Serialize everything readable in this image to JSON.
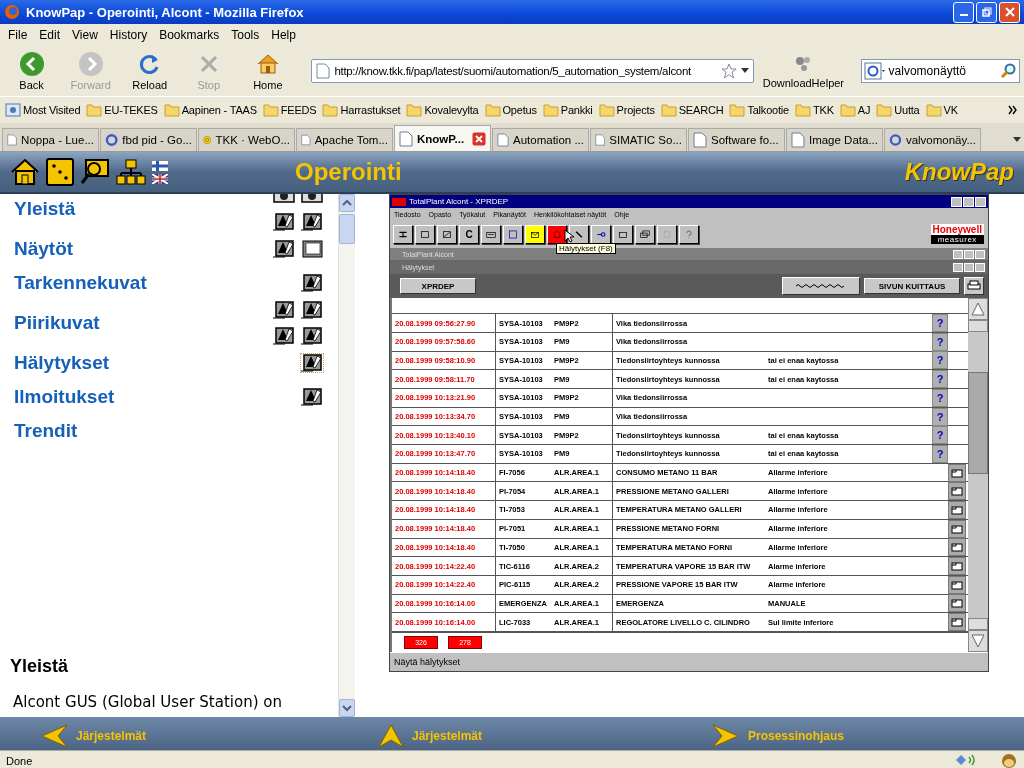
{
  "window": {
    "title": "KnowPap - Operointi, Alcont - Mozilla Firefox"
  },
  "menu": [
    "File",
    "Edit",
    "View",
    "History",
    "Bookmarks",
    "Tools",
    "Help"
  ],
  "toolbar": [
    {
      "kind": "back",
      "label": "Back",
      "disabled": false
    },
    {
      "kind": "forward",
      "label": "Forward",
      "disabled": true
    },
    {
      "kind": "reload",
      "label": "Reload",
      "disabled": false
    },
    {
      "kind": "stop",
      "label": "Stop",
      "disabled": true
    },
    {
      "kind": "home",
      "label": "Home",
      "disabled": false
    }
  ],
  "address": {
    "value": "http://know.tkk.fi/pap/latest/suomi/automation/5_automation_system/alcont"
  },
  "download_helper": "DownloadHelper",
  "search": {
    "value": "valvomonäyttö"
  },
  "bookmarks": [
    {
      "kind": "special",
      "label": "Most Visited"
    },
    {
      "kind": "folder",
      "label": "EU-TEKES"
    },
    {
      "kind": "folder",
      "label": "Aapinen - TAAS"
    },
    {
      "kind": "folder",
      "label": "FEEDS"
    },
    {
      "kind": "folder",
      "label": "Harrastukset"
    },
    {
      "kind": "folder",
      "label": "Kovalevylta"
    },
    {
      "kind": "folder",
      "label": "Opetus"
    },
    {
      "kind": "folder",
      "label": "Pankki"
    },
    {
      "kind": "folder",
      "label": "Projects"
    },
    {
      "kind": "folder",
      "label": "SEARCH"
    },
    {
      "kind": "folder",
      "label": "Talkootie"
    },
    {
      "kind": "folder",
      "label": "TKK"
    },
    {
      "kind": "folder",
      "label": "AJ"
    },
    {
      "kind": "folder",
      "label": "Uutta"
    },
    {
      "kind": "folder",
      "label": "VK"
    }
  ],
  "tabs": [
    {
      "kind": "page",
      "label": "Noppa - Lue...",
      "selected": false
    },
    {
      "kind": "search",
      "label": "fbd pid - Go...",
      "selected": false
    },
    {
      "kind": "badge",
      "label": "TKK · WebO...",
      "selected": false
    },
    {
      "kind": "page",
      "label": "Apache Tom...",
      "selected": false
    },
    {
      "kind": "page",
      "label": "KnowP...",
      "selected": true
    },
    {
      "kind": "page",
      "label": "Automation ...",
      "selected": false
    },
    {
      "kind": "page",
      "label": "SIMATIC So...",
      "selected": false
    },
    {
      "kind": "page",
      "label": "Software fo...",
      "selected": false
    },
    {
      "kind": "page",
      "label": "Image Data...",
      "selected": false
    },
    {
      "kind": "search",
      "label": "valvomonäy...",
      "selected": false
    }
  ],
  "page": {
    "title": "Operointi",
    "logo": "KnowPap",
    "nav": [
      {
        "label": "Yleistä",
        "focused": false,
        "icon_rows": [
          [
            {
              "kind": "camera"
            },
            {
              "kind": "camera"
            }
          ],
          [
            {
              "kind": "doc"
            },
            {
              "kind": "doc"
            }
          ]
        ]
      },
      {
        "label": "Näytöt",
        "focused": false,
        "icon_rows": [
          [
            {
              "kind": "doc"
            },
            {
              "kind": "window"
            }
          ]
        ]
      },
      {
        "label": "Tarkennekuvat",
        "focused": false,
        "icon_rows": [
          [
            {
              "kind": "doc"
            }
          ]
        ]
      },
      {
        "label": "Piirikuvat",
        "focused": false,
        "icon_rows": [
          [
            {
              "kind": "doc"
            },
            {
              "kind": "doc"
            }
          ],
          [
            {
              "kind": "doc"
            },
            {
              "kind": "doc"
            }
          ]
        ]
      },
      {
        "label": "Hälytykset",
        "focused": true,
        "icon_rows": [
          [
            {
              "kind": "doc"
            }
          ]
        ]
      },
      {
        "label": "Ilmoitukset",
        "focused": false,
        "icon_rows": [
          [
            {
              "kind": "doc"
            }
          ]
        ]
      },
      {
        "label": "Trendit",
        "focused": false
      }
    ],
    "section_heading": "Yleistä",
    "section_text": "Alcont GUS (Global User Station) on",
    "footer_links": [
      {
        "kind": "left",
        "label": "Järjestelmät"
      },
      {
        "kind": "up",
        "label": "Järjestelmät"
      },
      {
        "kind": "right",
        "label": "Prosessinohjaus"
      }
    ]
  },
  "alarm_app": {
    "title": "TotalPlant Alcont - XPRDEP",
    "menu": [
      "Tiedosto",
      "Opasto",
      "Työkalut",
      "Pikanäytöt",
      "Henkilökohtaiset näytöt",
      "Ohje"
    ],
    "tools": [
      {
        "kind": "network",
        "color": "#c0c0c0"
      },
      {
        "kind": "rect",
        "color": "#c0c0c0"
      },
      {
        "kind": "image",
        "color": "#c0c0c0"
      },
      {
        "kind": "text",
        "label": "C",
        "color": "#c0c0c0"
      },
      {
        "kind": "keyboard",
        "color": "#c0c0c0"
      },
      {
        "kind": "save",
        "color": "#c0c0c0"
      },
      {
        "kind": "mail",
        "color": "#ffff00"
      },
      {
        "kind": "alarm",
        "color": "#ff0000"
      },
      {
        "kind": "pen",
        "color": "#c0c0c0"
      },
      {
        "kind": "key",
        "color": "#c0c0c0"
      },
      {
        "kind": "window",
        "color": "#c0c0c0"
      },
      {
        "kind": "windows",
        "color": "#c0c0c0"
      },
      {
        "kind": "blank",
        "color": "#c0c0c0"
      },
      {
        "kind": "help",
        "color": "#c0c0c0"
      }
    ],
    "tooltip": "Hälytykset (F8)",
    "logo": "Honeywell",
    "logo_sub": "measurex",
    "parent_window": "TotalPlant Alcont",
    "child_window": "Hälytykset",
    "area_button": "XPRDEP",
    "ack_button": "SIVUN KUITTAUS",
    "rows": [
      {
        "time": "20.08.1999 09:56:27.90",
        "tag": "SYSA-10103",
        "area": "PM9P2",
        "description": "Vika tiedonsiirrossa",
        "kind": "help",
        "action_label": "?"
      },
      {
        "time": "20.08.1999 09:57:58.60",
        "tag": "SYSA-10103",
        "area": "PM9",
        "description": "Vika tiedonsiirrossa",
        "kind": "help",
        "action_label": "?"
      },
      {
        "time": "20.08.1999 09:58:10.90",
        "tag": "SYSA-10103",
        "area": "PM9P2",
        "description": "Tiedonsiirtoyhteys kunnossa",
        "status": "tai ei enaa kaytossa",
        "kind": "help",
        "action_label": "?"
      },
      {
        "time": "20.08.1999 09:58:11.70",
        "tag": "SYSA-10103",
        "area": "PM9",
        "description": "Tiedonsiirtoyhteys kunnossa",
        "status": "tai ei enaa kaytossa",
        "kind": "help",
        "action_label": "?"
      },
      {
        "time": "20.08.1999 10:13:21.90",
        "tag": "SYSA-10103",
        "area": "PM9P2",
        "description": "Vika tiedonsiirrossa",
        "kind": "help",
        "action_label": "?"
      },
      {
        "time": "20.08.1999 10:13:34.70",
        "tag": "SYSA-10103",
        "area": "PM9",
        "description": "Vika tiedonsiirrossa",
        "kind": "help",
        "action_label": "?"
      },
      {
        "time": "20.08.1999 10:13:40.10",
        "tag": "SYSA-10103",
        "area": "PM9P2",
        "description": "Tiedonsiirtoyhteys kunnossa",
        "status": "tai ei enaa kaytossa",
        "kind": "help",
        "action_label": "?"
      },
      {
        "time": "20.08.1999 10:13:47.70",
        "tag": "SYSA-10103",
        "area": "PM9",
        "description": "Tiedonsiirtoyhteys kunnossa",
        "status": "tai ei enaa kaytossa",
        "kind": "help",
        "action_label": "?"
      },
      {
        "time": "20.08.1999 10:14:18.40",
        "tag": "FI-7056",
        "area": "ALR.AREA.1",
        "description": "CONSUMO METANO 11 BAR",
        "status": "Allarme inferiore",
        "kind": "detail"
      },
      {
        "time": "20.08.1999 10:14:18.40",
        "tag": "PI-7054",
        "area": "ALR.AREA.1",
        "description": "PRESSIONE METANO GALLERI",
        "status": "Allarme inferiore",
        "kind": "detail"
      },
      {
        "time": "20.08.1999 10:14:18.40",
        "tag": "TI-7053",
        "area": "ALR.AREA.1",
        "description": "TEMPERATURA METANO GALLERI",
        "status": "Allarme inferiore",
        "kind": "detail"
      },
      {
        "time": "20.08.1999 10:14:18.40",
        "tag": "PI-7051",
        "area": "ALR.AREA.1",
        "description": "PRESSIONE METANO FORNI",
        "status": "Allarme inferiore",
        "kind": "detail"
      },
      {
        "time": "20.08.1999 10:14:18.40",
        "tag": "TI-7050",
        "area": "ALR.AREA.1",
        "description": "TEMPERATURA METANO FORNI",
        "status": "Allarme inferiore",
        "kind": "detail"
      },
      {
        "time": "20.08.1999 10:14:22.40",
        "tag": "TIC-6116",
        "area": "ALR.AREA.2",
        "description": "TEMPERATURA VAPORE 15 BAR ITW",
        "status": "Alarme inferiore",
        "kind": "detail"
      },
      {
        "time": "20.08.1999 10:14:22.40",
        "tag": "PIC-6115",
        "area": "ALR.AREA.2",
        "description": "PRESSIONE VAPORE 15 BAR ITW",
        "status": "Alarme inferiore",
        "kind": "detail"
      },
      {
        "time": "20.08.1999 10:16:14.00",
        "tag": "EMERGENZA",
        "area": "ALR.AREA.1",
        "description": "EMERGENZA",
        "status": "MANUALE",
        "kind": "detail"
      },
      {
        "time": "20.08.1999 10:16:14.00",
        "tag": "LIC-7033",
        "area": "ALR.AREA.1",
        "description": "REGOLATORE LIVELLO C. CILINDRO",
        "status": "Sul limite inferiore",
        "kind": "detail"
      }
    ],
    "counters": [
      "326",
      "278"
    ],
    "status": "Näytä hälytykset"
  },
  "status_bar": {
    "text": "Done"
  }
}
